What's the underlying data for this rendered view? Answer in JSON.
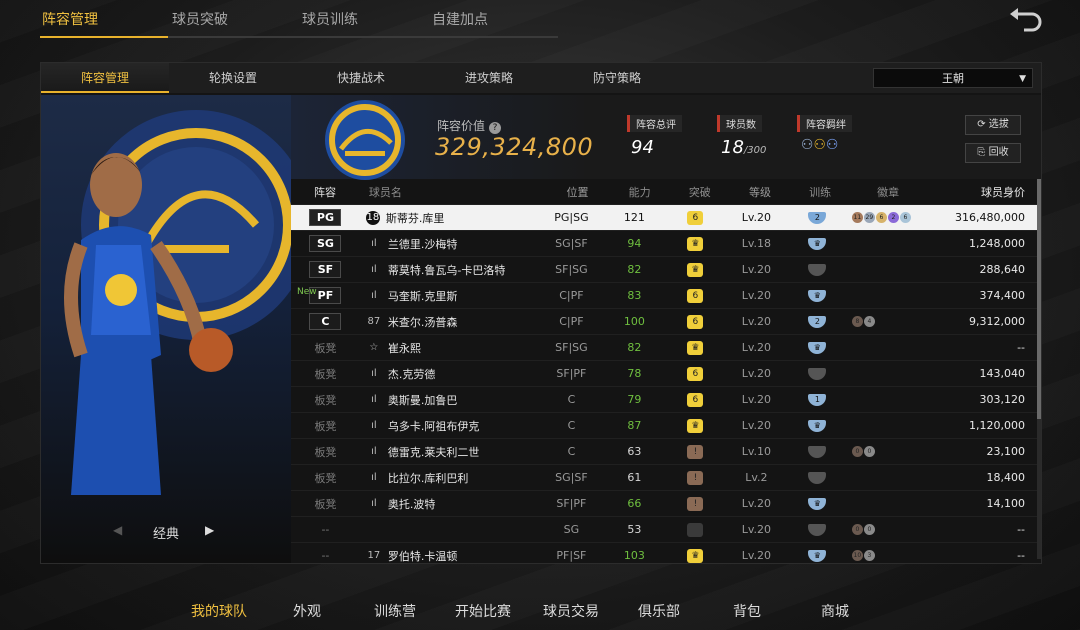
{
  "top_tabs": [
    "阵容管理",
    "球员突破",
    "球员训练",
    "自建加点"
  ],
  "top_tab_active": 0,
  "sub_tabs": [
    "阵容管理",
    "轮换设置",
    "快捷战术",
    "进攻策略",
    "防守策略"
  ],
  "sub_tab_active": 0,
  "team_select": "王朝",
  "showcase": {
    "label": "经典"
  },
  "summary": {
    "value_label": "阵容价值",
    "value": "329,324,800",
    "rating_label": "阵容总评",
    "rating": "94",
    "count_label": "球员数",
    "count": "18",
    "count_max": "/300",
    "bond_label": "阵容羁绊",
    "btn_pick": "选拔",
    "btn_recycle": "回收"
  },
  "columns": {
    "pos": "阵容",
    "name": "球员名",
    "position": "位置",
    "ability": "能力",
    "breakthrough": "突破",
    "level": "等级",
    "training": "训练",
    "badge": "徽章",
    "salary": "球员身价"
  },
  "rows": [
    {
      "slot": "PG",
      "starter": true,
      "sig": "18",
      "name": "斯蒂芬.库里",
      "position": "PG|SG",
      "ability": "121",
      "green": false,
      "brk": "6",
      "brk_color": "#f0cf3a",
      "level": "Lv.20",
      "trn": "2",
      "trn_color": "#7aa8d8",
      "badges": [
        "11",
        "29",
        "6",
        "2",
        "6"
      ],
      "salary": "316,480,000",
      "selected": true
    },
    {
      "slot": "SG",
      "starter": true,
      "sig": "ıl",
      "name": "兰德里.沙梅特",
      "position": "SG|SF",
      "ability": "94",
      "green": true,
      "brk": "♛",
      "brk_color": "#f0cf3a",
      "level": "Lv.18",
      "trn": "♛",
      "trn_color": "#8fb3d6",
      "badges": [],
      "salary": "1,248,000"
    },
    {
      "slot": "SF",
      "starter": true,
      "sig": "ıl",
      "name": "蒂莫特.鲁瓦乌-卡巴洛特",
      "position": "SF|SG",
      "ability": "82",
      "green": true,
      "brk": "♛",
      "brk_color": "#f0cf3a",
      "level": "Lv.20",
      "trn": "",
      "trn_color": "#555",
      "badges": [],
      "salary": "288,640"
    },
    {
      "slot": "PF",
      "starter": true,
      "new": "New",
      "sig": "ıl",
      "name": "马奎斯.克里斯",
      "position": "C|PF",
      "ability": "83",
      "green": true,
      "brk": "6",
      "brk_color": "#f0cf3a",
      "level": "Lv.20",
      "trn": "♛",
      "trn_color": "#8fb3d6",
      "badges": [],
      "salary": "374,400"
    },
    {
      "slot": "C",
      "starter": true,
      "sig": "87",
      "name": "米查尔.汤普森",
      "position": "C|PF",
      "ability": "100",
      "green": true,
      "brk": "6",
      "brk_color": "#f0cf3a",
      "level": "Lv.20",
      "trn": "2",
      "trn_color": "#8fb3d6",
      "badges": [
        "8",
        "4"
      ],
      "salary": "9,312,000"
    },
    {
      "slot": "板凳",
      "starter": false,
      "sig": "☆",
      "name": "崔永熙",
      "position": "SF|SG",
      "ability": "82",
      "green": true,
      "brk": "♛",
      "brk_color": "#f0cf3a",
      "level": "Lv.20",
      "trn": "♛",
      "trn_color": "#8fb3d6",
      "badges": [],
      "salary": "--"
    },
    {
      "slot": "板凳",
      "starter": false,
      "sig": "ıl",
      "name": "杰.克劳德",
      "position": "SF|PF",
      "ability": "78",
      "green": true,
      "brk": "6",
      "brk_color": "#f0cf3a",
      "level": "Lv.20",
      "trn": "",
      "trn_color": "#555",
      "badges": [],
      "salary": "143,040"
    },
    {
      "slot": "板凳",
      "starter": false,
      "sig": "ıl",
      "name": "奥斯曼.加鲁巴",
      "position": "C",
      "ability": "79",
      "green": true,
      "brk": "6",
      "brk_color": "#f0cf3a",
      "level": "Lv.20",
      "trn": "1",
      "trn_color": "#8fb3d6",
      "badges": [],
      "salary": "303,120"
    },
    {
      "slot": "板凳",
      "starter": false,
      "sig": "ıl",
      "name": "乌多卡.阿祖布伊克",
      "position": "C",
      "ability": "87",
      "green": true,
      "brk": "♛",
      "brk_color": "#f0cf3a",
      "level": "Lv.20",
      "trn": "♛",
      "trn_color": "#8fb3d6",
      "badges": [],
      "salary": "1,120,000"
    },
    {
      "slot": "板凳",
      "starter": false,
      "sig": "ıl",
      "name": "德雷克.莱夫利二世",
      "position": "C",
      "ability": "63",
      "green": false,
      "brk": "!",
      "brk_color": "#8a6a55",
      "level": "Lv.10",
      "trn": "",
      "trn_color": "#555",
      "badges": [
        "0",
        "0"
      ],
      "salary": "23,100"
    },
    {
      "slot": "板凳",
      "starter": false,
      "sig": "ıl",
      "name": "比拉尔.库利巴利",
      "position": "SG|SF",
      "ability": "61",
      "green": false,
      "brk": "!",
      "brk_color": "#8a6a55",
      "level": "Lv.2",
      "trn": "",
      "trn_color": "#555",
      "badges": [],
      "salary": "18,400"
    },
    {
      "slot": "板凳",
      "starter": false,
      "sig": "ıl",
      "name": "奥托.波特",
      "position": "SF|PF",
      "ability": "66",
      "green": true,
      "brk": "!",
      "brk_color": "#8a6a55",
      "level": "Lv.20",
      "trn": "♛",
      "trn_color": "#8fb3d6",
      "badges": [],
      "salary": "14,100"
    },
    {
      "slot": "--",
      "starter": false,
      "sig": "",
      "name": "",
      "position": "SG",
      "ability": "53",
      "green": false,
      "brk": "",
      "brk_color": "#555",
      "level": "Lv.20",
      "trn": "",
      "trn_color": "#555",
      "badges": [
        "0",
        "0"
      ],
      "salary": "--"
    },
    {
      "slot": "--",
      "starter": false,
      "sig": "17",
      "name": "罗伯特.卡温顿",
      "position": "PF|SF",
      "ability": "103",
      "green": true,
      "brk": "♛",
      "brk_color": "#f0cf3a",
      "level": "Lv.20",
      "trn": "♛",
      "trn_color": "#8fb3d6",
      "badges": [
        "10",
        "3"
      ],
      "salary": "--"
    }
  ],
  "bottom_nav": [
    "我的球队",
    "外观",
    "训练营",
    "开始比赛",
    "球员交易",
    "俱乐部",
    "背包",
    "商城"
  ],
  "bottom_nav_active": 0,
  "colors": {
    "accent": "#e8b22c",
    "value": "#e8b14a",
    "green": "#6fbf3f"
  }
}
